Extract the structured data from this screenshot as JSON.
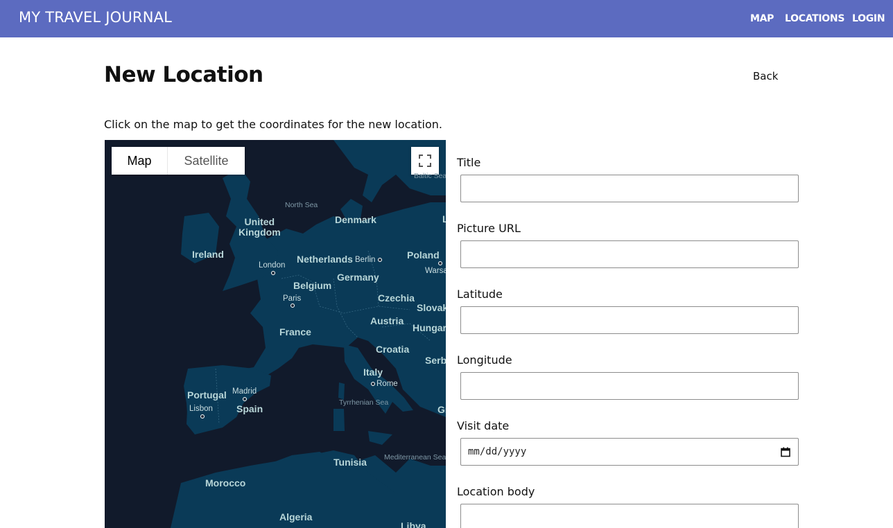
{
  "nav": {
    "brand": "MY TRAVEL JOURNAL",
    "links": [
      "MAP",
      "LOCATIONS",
      "LOGIN"
    ],
    "color": "#5c6bc0"
  },
  "page": {
    "title": "New Location",
    "back_label": "Back",
    "instruction": "Click on the map to get the coordinates for the new location."
  },
  "map": {
    "type_options": [
      "Map",
      "Satellite"
    ],
    "selected_type": "Map",
    "fullscreen_icon": "fullscreen-icon",
    "theme": {
      "land": "#0a3a57",
      "water": "#111a2b"
    },
    "country_labels": [
      "United Kingdom",
      "Ireland",
      "Netherlands",
      "Denmark",
      "Poland",
      "Germany",
      "Belgium",
      "Czechia",
      "Slovak",
      "France",
      "Austria",
      "Hungary",
      "Croatia",
      "Serb",
      "Italy",
      "Portugal",
      "Spain",
      "Gr",
      "Tunisia",
      "Morocco",
      "Algeria",
      "Libya",
      "L"
    ],
    "city_labels": [
      "London",
      "Berlin",
      "Warsa",
      "Paris",
      "Rome",
      "Madrid",
      "Lisbon"
    ],
    "sea_labels": [
      "North Sea",
      "Baltic Sea",
      "Tyrrhenian Sea",
      "Mediterranean Sea"
    ]
  },
  "form": {
    "fields": [
      {
        "label": "Title",
        "value": ""
      },
      {
        "label": "Picture URL",
        "value": ""
      },
      {
        "label": "Latitude",
        "value": ""
      },
      {
        "label": "Longitude",
        "value": ""
      },
      {
        "label": "Visit date",
        "placeholder": "mm/dd/yyyy"
      },
      {
        "label": "Location body",
        "value": ""
      }
    ]
  }
}
